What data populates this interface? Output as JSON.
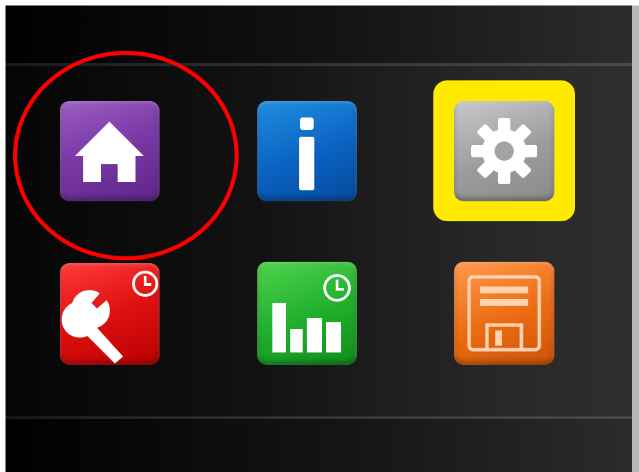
{
  "toolbar": {
    "tiles": [
      {
        "icon": "home-icon",
        "color": "#7b3aa7"
      },
      {
        "icon": "info-icon",
        "color": "#0a62c2"
      },
      {
        "icon": "gear-icon",
        "color": "#9c9c9c",
        "selected": true,
        "selection_color": "#ffea00"
      },
      {
        "icon": "wrench-clock-icon",
        "color": "#e01010"
      },
      {
        "icon": "bar-chart-clock-icon",
        "color": "#1fae2a"
      },
      {
        "icon": "floppy-disk-icon",
        "color": "#ec6b12"
      }
    ]
  },
  "annotation": {
    "shape": "circle",
    "color": "#ff0000",
    "target": "home-tile"
  }
}
